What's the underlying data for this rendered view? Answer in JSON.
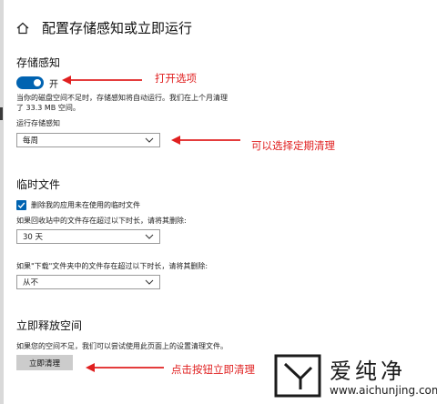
{
  "header": {
    "title": "配置存储感知或立即运行"
  },
  "storage_sense": {
    "title": "存储感知",
    "toggle_label": "开",
    "desc_line1": "当你的磁盘空间不足时，存储感知将自动运行。我们在上个月清理",
    "desc_line2": "了 33.3 MB 空间。",
    "run_label": "运行存储感知",
    "run_value": "每周"
  },
  "temp_files": {
    "title": "临时文件",
    "checkbox_label": "删除我的应用未在使用的临时文件",
    "recycle_label": "如果回收站中的文件存在超过以下时长，请将其删除:",
    "recycle_value": "30 天",
    "downloads_label": "如果\"下载\"文件夹中的文件存在超过以下时长，请将其删除:",
    "downloads_value": "从不"
  },
  "free_space": {
    "title": "立即释放空间",
    "desc": "如果您的空间不足，我们可以尝试使用此页面上的设置清理文件。",
    "button_label": "立即清理"
  },
  "annotations": {
    "open_option": "打开选项",
    "schedule": "可以选择定期清理",
    "click_button": "点击按钮立即清理"
  },
  "watermark": {
    "name": "爱纯净",
    "url": "www.aichunjing.com"
  },
  "colors": {
    "accent": "#0063b1",
    "annotation": "#e02020"
  }
}
